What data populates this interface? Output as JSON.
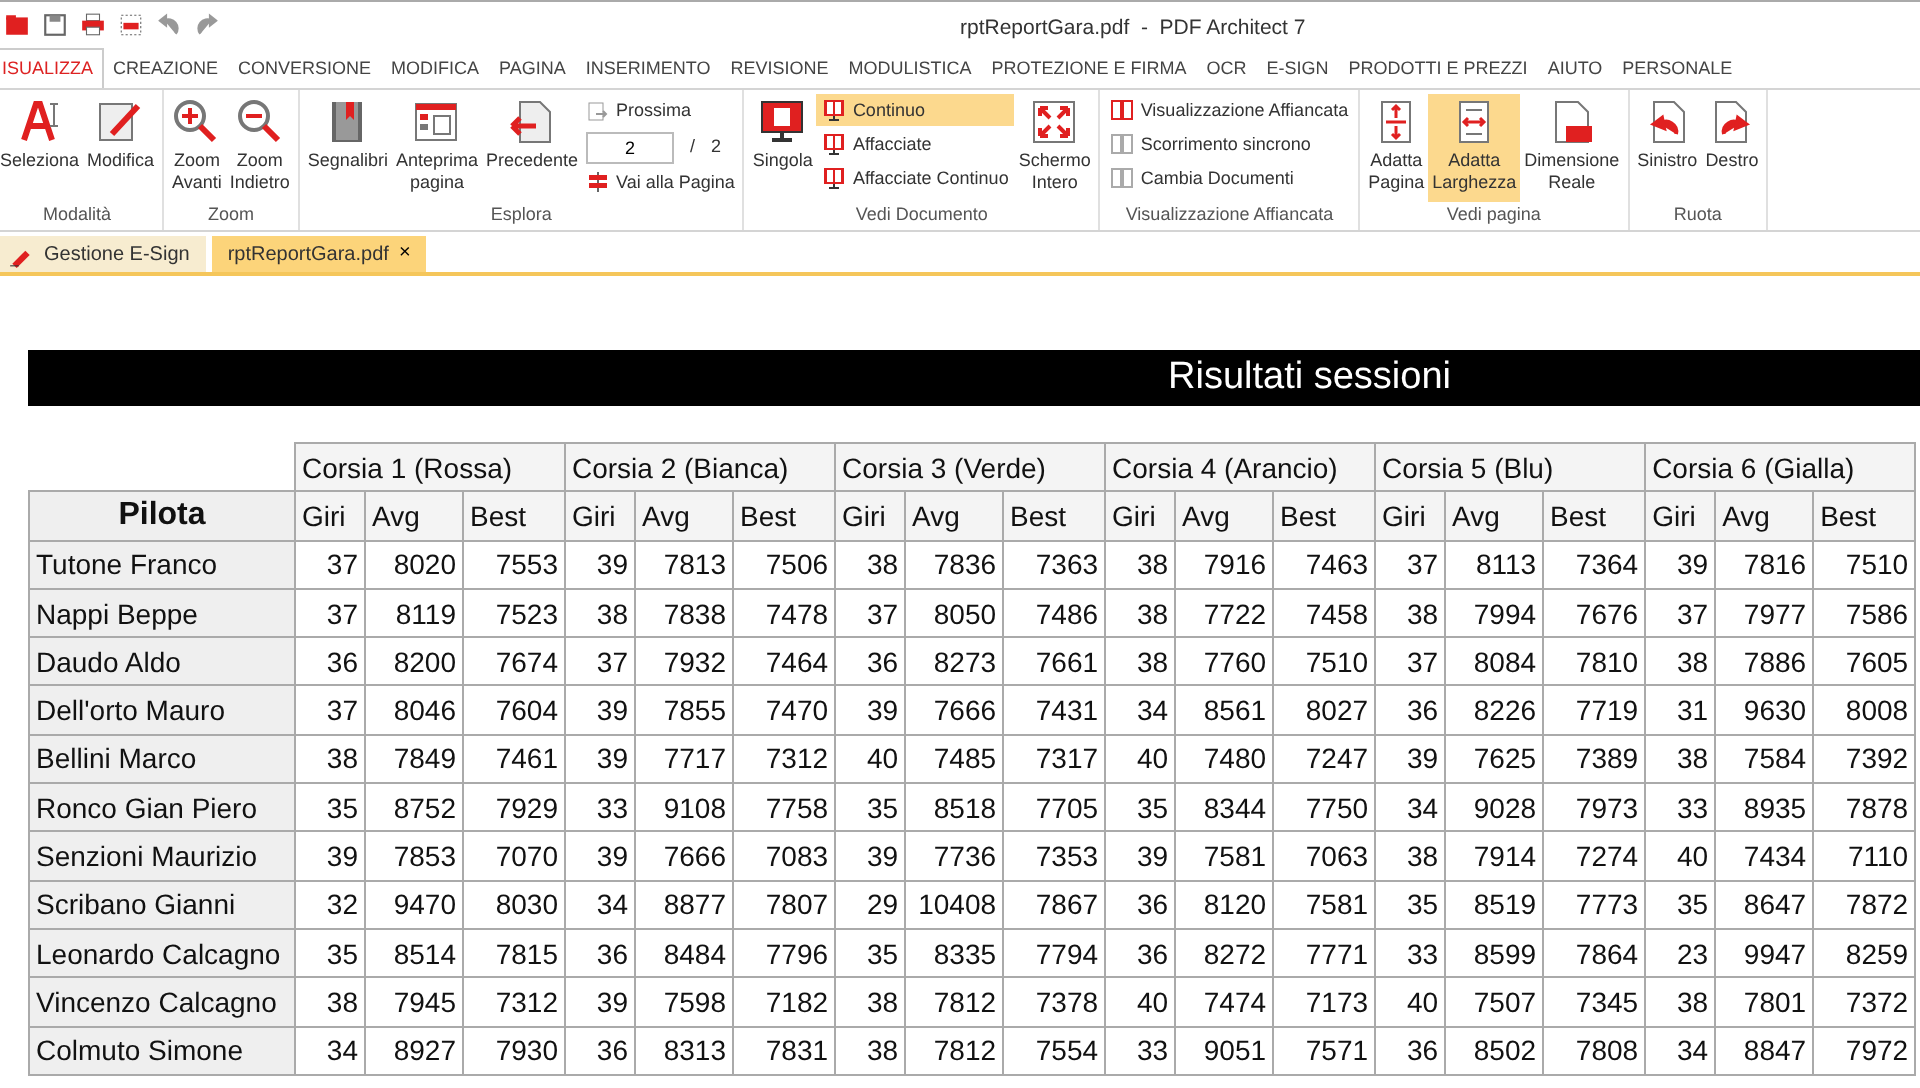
{
  "window": {
    "title": "rptReportGara.pdf  -  PDF Architect 7"
  },
  "menu_tabs": [
    {
      "label": "ISUALIZZA",
      "selected": true
    },
    {
      "label": "CREAZIONE",
      "selected": false
    },
    {
      "label": "CONVERSIONE",
      "selected": false
    },
    {
      "label": "MODIFICA",
      "selected": false
    },
    {
      "label": "PAGINA",
      "selected": false
    },
    {
      "label": "INSERIMENTO",
      "selected": false
    },
    {
      "label": "REVISIONE",
      "selected": false
    },
    {
      "label": "MODULISTICA",
      "selected": false
    },
    {
      "label": "PROTEZIONE E FIRMA",
      "selected": false
    },
    {
      "label": "OCR",
      "selected": false
    },
    {
      "label": "E-SIGN",
      "selected": false
    },
    {
      "label": "PRODOTTI E PREZZI",
      "selected": false
    },
    {
      "label": "AIUTO",
      "selected": false
    },
    {
      "label": "PERSONALE",
      "selected": false
    }
  ],
  "ribbon": [
    {
      "label": "Modalità",
      "items": [
        {
          "kind": "large",
          "label": "Seleziona",
          "selected": false
        },
        {
          "kind": "large",
          "label": "Modifica",
          "selected": false
        }
      ]
    },
    {
      "label": "Zoom",
      "items": [
        {
          "kind": "large",
          "label": "Zoom Avanti",
          "selected": false
        },
        {
          "kind": "large",
          "label": "Zoom Indietro",
          "selected": false
        }
      ]
    },
    {
      "label": "Esplora",
      "items": [
        {
          "kind": "large",
          "label": "Segnalibri",
          "selected": false
        },
        {
          "kind": "large",
          "label": "Anteprima pagina",
          "selected": false
        },
        {
          "kind": "large",
          "label": "Precedente",
          "selected": false
        },
        {
          "kind": "pager",
          "next": "Prossima",
          "page": "2",
          "separator": "/",
          "total": "2",
          "goto": "Vai alla Pagina"
        }
      ]
    },
    {
      "label": "Vedi Documento",
      "items": [
        {
          "kind": "large",
          "label": "Singola",
          "selected": false
        },
        {
          "kind": "stack",
          "entries": [
            {
              "label": "Continuo",
              "selected": true,
              "disabled": false
            },
            {
              "label": "Affacciate",
              "selected": false,
              "disabled": false
            },
            {
              "label": "Affacciate Continuo",
              "selected": false,
              "disabled": false
            }
          ]
        },
        {
          "kind": "large",
          "label": "Schermo Intero",
          "selected": false
        }
      ]
    },
    {
      "label": "Visualizzazione Affiancata",
      "items": [
        {
          "kind": "stack",
          "entries": [
            {
              "label": "Visualizzazione Affiancata",
              "selected": false,
              "disabled": false
            },
            {
              "label": "Scorrimento sincrono",
              "selected": false,
              "disabled": true
            },
            {
              "label": "Cambia Documenti",
              "selected": false,
              "disabled": true
            }
          ]
        }
      ]
    },
    {
      "label": "Vedi pagina",
      "items": [
        {
          "kind": "large",
          "label": "Adatta Pagina",
          "selected": false
        },
        {
          "kind": "large",
          "label": "Adatta Larghezza",
          "selected": true
        },
        {
          "kind": "large",
          "label": "Dimensione Reale",
          "selected": false
        }
      ]
    },
    {
      "label": "Ruota",
      "items": [
        {
          "kind": "large",
          "label": "Sinistro",
          "selected": false
        },
        {
          "kind": "large",
          "label": "Destro",
          "selected": false
        }
      ]
    }
  ],
  "doc_tabs": [
    {
      "label": "Gestione E-Sign",
      "selected": false,
      "closable": false
    },
    {
      "label": "rptReportGara.pdf",
      "selected": true,
      "closable": true,
      "close": "×"
    }
  ],
  "report": {
    "title": "Risultati sessioni",
    "groups": [
      {
        "label": "Corsia 1 (Rossa)",
        "subheaders": [
          "Giri",
          "Avg",
          "Best"
        ]
      },
      {
        "label": "Corsia 2 (Bianca)",
        "subheaders": [
          "Giri",
          "Avg",
          "Best"
        ]
      },
      {
        "label": "Corsia 3 (Verde)",
        "subheaders": [
          "Giri",
          "Avg",
          "Best"
        ]
      },
      {
        "label": "Corsia 4 (Arancio)",
        "subheaders": [
          "Giri",
          "Avg",
          "Best"
        ]
      },
      {
        "label": "Corsia 5 (Blu)",
        "subheaders": [
          "Giri",
          "Avg",
          "Best"
        ]
      },
      {
        "label": "Corsia 6 (Gialla)",
        "subheaders": [
          "Giri",
          "Avg",
          "Best"
        ]
      }
    ],
    "pilot_header": "Pilota",
    "rows": [
      {
        "pilot": "Tutone Franco",
        "cells": [
          "37",
          "8020",
          "7553",
          "39",
          "7813",
          "7506",
          "38",
          "7836",
          "7363",
          "38",
          "7916",
          "7463",
          "37",
          "8113",
          "7364",
          "39",
          "7816",
          "7510"
        ]
      },
      {
        "pilot": "Nappi Beppe",
        "cells": [
          "37",
          "8119",
          "7523",
          "38",
          "7838",
          "7478",
          "37",
          "8050",
          "7486",
          "38",
          "7722",
          "7458",
          "38",
          "7994",
          "7676",
          "37",
          "7977",
          "7586"
        ]
      },
      {
        "pilot": "Daudo Aldo",
        "cells": [
          "36",
          "8200",
          "7674",
          "37",
          "7932",
          "7464",
          "36",
          "8273",
          "7661",
          "38",
          "7760",
          "7510",
          "37",
          "8084",
          "7810",
          "38",
          "7886",
          "7605"
        ]
      },
      {
        "pilot": "Dell'orto Mauro",
        "cells": [
          "37",
          "8046",
          "7604",
          "39",
          "7855",
          "7470",
          "39",
          "7666",
          "7431",
          "34",
          "8561",
          "8027",
          "36",
          "8226",
          "7719",
          "31",
          "9630",
          "8008"
        ]
      },
      {
        "pilot": "Bellini Marco",
        "cells": [
          "38",
          "7849",
          "7461",
          "39",
          "7717",
          "7312",
          "40",
          "7485",
          "7317",
          "40",
          "7480",
          "7247",
          "39",
          "7625",
          "7389",
          "38",
          "7584",
          "7392"
        ]
      },
      {
        "pilot": "Ronco Gian Piero",
        "cells": [
          "35",
          "8752",
          "7929",
          "33",
          "9108",
          "7758",
          "35",
          "8518",
          "7705",
          "35",
          "8344",
          "7750",
          "34",
          "9028",
          "7973",
          "33",
          "8935",
          "7878"
        ]
      },
      {
        "pilot": "Senzioni Maurizio",
        "cells": [
          "39",
          "7853",
          "7070",
          "39",
          "7666",
          "7083",
          "39",
          "7736",
          "7353",
          "39",
          "7581",
          "7063",
          "38",
          "7914",
          "7274",
          "40",
          "7434",
          "7110"
        ]
      },
      {
        "pilot": "Scribano Gianni",
        "cells": [
          "32",
          "9470",
          "8030",
          "34",
          "8877",
          "7807",
          "29",
          "10408",
          "7867",
          "36",
          "8120",
          "7581",
          "35",
          "8519",
          "7773",
          "35",
          "8647",
          "7872"
        ]
      },
      {
        "pilot": "Leonardo Calcagno",
        "cells": [
          "35",
          "8514",
          "7815",
          "36",
          "8484",
          "7796",
          "35",
          "8335",
          "7794",
          "36",
          "8272",
          "7771",
          "33",
          "8599",
          "7864",
          "23",
          "9947",
          "8259"
        ]
      },
      {
        "pilot": "Vincenzo Calcagno",
        "cells": [
          "38",
          "7945",
          "7312",
          "39",
          "7598",
          "7182",
          "38",
          "7812",
          "7378",
          "40",
          "7474",
          "7173",
          "40",
          "7507",
          "7345",
          "38",
          "7801",
          "7372"
        ]
      },
      {
        "pilot": "Colmuto Simone",
        "cells": [
          "34",
          "8927",
          "7930",
          "36",
          "8313",
          "7831",
          "38",
          "7812",
          "7554",
          "33",
          "9051",
          "7571",
          "36",
          "8502",
          "7808",
          "34",
          "8847",
          "7972"
        ]
      }
    ]
  }
}
